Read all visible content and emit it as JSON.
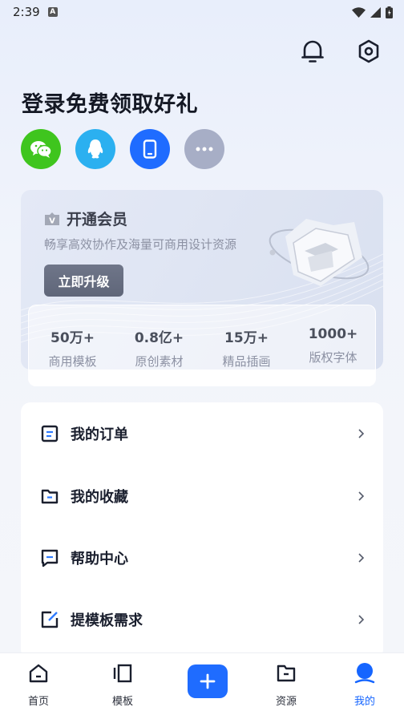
{
  "status_bar": {
    "time": "2:39",
    "notification_letter": "A"
  },
  "header": {
    "login_title": "登录免费领取好礼"
  },
  "login_options": [
    {
      "name": "wechat",
      "color": "#3fc51e",
      "icon": "wechat-icon"
    },
    {
      "name": "qq",
      "color": "#2bb0f0",
      "icon": "qq-penguin-icon"
    },
    {
      "name": "phone",
      "color": "#1f6cff",
      "icon": "phone-icon"
    },
    {
      "name": "more",
      "color": "#a7aec6",
      "icon": "more-icon"
    }
  ],
  "vip": {
    "title": "开通会员",
    "badge": "V",
    "subtitle": "畅享高效协作及海量可商用设计资源",
    "upgrade_label": "立即升级",
    "stats": [
      {
        "value": "50万+",
        "label": "商用模板"
      },
      {
        "value": "0.8亿+",
        "label": "原创素材"
      },
      {
        "value": "15万+",
        "label": "精品插画"
      },
      {
        "value": "1000+",
        "label": "版权字体"
      }
    ]
  },
  "menu": [
    {
      "label": "我的订单",
      "icon": "order-icon"
    },
    {
      "label": "我的收藏",
      "icon": "folder-icon"
    },
    {
      "label": "帮助中心",
      "icon": "help-chat-icon"
    },
    {
      "label": "提模板需求",
      "icon": "edit-icon"
    }
  ],
  "bottom_nav": {
    "items": [
      {
        "label": "首页",
        "icon": "home-icon"
      },
      {
        "label": "模板",
        "icon": "template-icon"
      },
      {
        "label": "资源",
        "icon": "folder-icon"
      },
      {
        "label": "我的",
        "icon": "profile-icon"
      }
    ],
    "active": "我的",
    "accent": "#1565ff"
  }
}
